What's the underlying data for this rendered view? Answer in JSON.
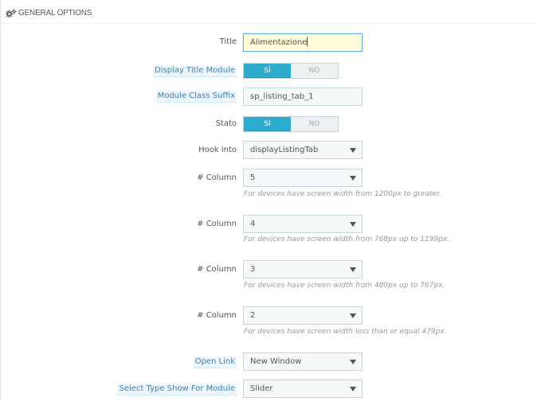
{
  "panel": {
    "heading": "General Options",
    "heading_icon": "gears-icon"
  },
  "fields": {
    "title": {
      "label": "Title",
      "value": "Alimentazione"
    },
    "display_title": {
      "label": "Display Title Module",
      "on_label": "SÌ",
      "off_label": "NO",
      "selected": "SÌ"
    },
    "class_suffix": {
      "label": "Module Class Suffix",
      "value": "sp_listing_tab_1"
    },
    "stato": {
      "label": "Stato",
      "on_label": "SÌ",
      "off_label": "NO",
      "selected": "SÌ"
    },
    "hook_into": {
      "label": "Hook into",
      "value": "displayListingTab"
    },
    "columns": [
      {
        "label": "# Column",
        "value": "5",
        "help": "For devices have screen width from 1200px to greater."
      },
      {
        "label": "# Column",
        "value": "4",
        "help": "For devices have screen width from 768px up to 1199px."
      },
      {
        "label": "# Column",
        "value": "3",
        "help": "For devices have screen width from 480px up to 767px."
      },
      {
        "label": "# Column",
        "value": "2",
        "help": "For devices have screen width less than or equal 479px."
      }
    ],
    "open_link": {
      "label": "Open Link",
      "value": "New Window"
    },
    "type_show": {
      "label": "Select Type Show For Module",
      "value": "Slider"
    }
  },
  "colors": {
    "toggle_on": "#2eacce",
    "hint_label": "#3b80b0",
    "active_input_bg": "#fffbd8"
  }
}
